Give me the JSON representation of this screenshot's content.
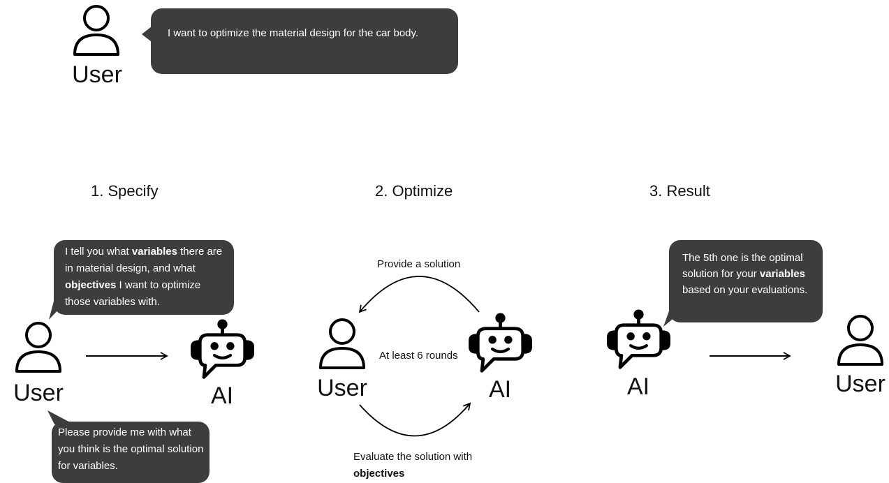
{
  "intro": {
    "user_label": "User",
    "message": "I want to optimize the material design for the car body."
  },
  "steps": {
    "specify": {
      "title": "1. Specify",
      "user_label": "User",
      "ai_label": "AI",
      "user_message": [
        "I tell you what ",
        "variables",
        " there are in material design, and what ",
        "objectives",
        " I want to optimize those variables with."
      ],
      "ai_message": "Please provide me with what you think is the optimal solution for variables."
    },
    "optimize": {
      "title": "2. Optimize",
      "user_label": "User",
      "ai_label": "AI",
      "top_arc_label": "Provide a solution",
      "center_label": "At least 6 rounds",
      "bottom_arc_label": "Evaluate the solution with",
      "bottom_arc_label_bold": "objectives"
    },
    "result": {
      "title": "3. Result",
      "ai_label": "AI",
      "user_label": "User",
      "ai_message": [
        "The 5th one is the optimal solution for your ",
        "variables",
        " based on your evaluations."
      ]
    }
  },
  "colors": {
    "bubble": "#3d3d3d",
    "text": "#111111"
  }
}
